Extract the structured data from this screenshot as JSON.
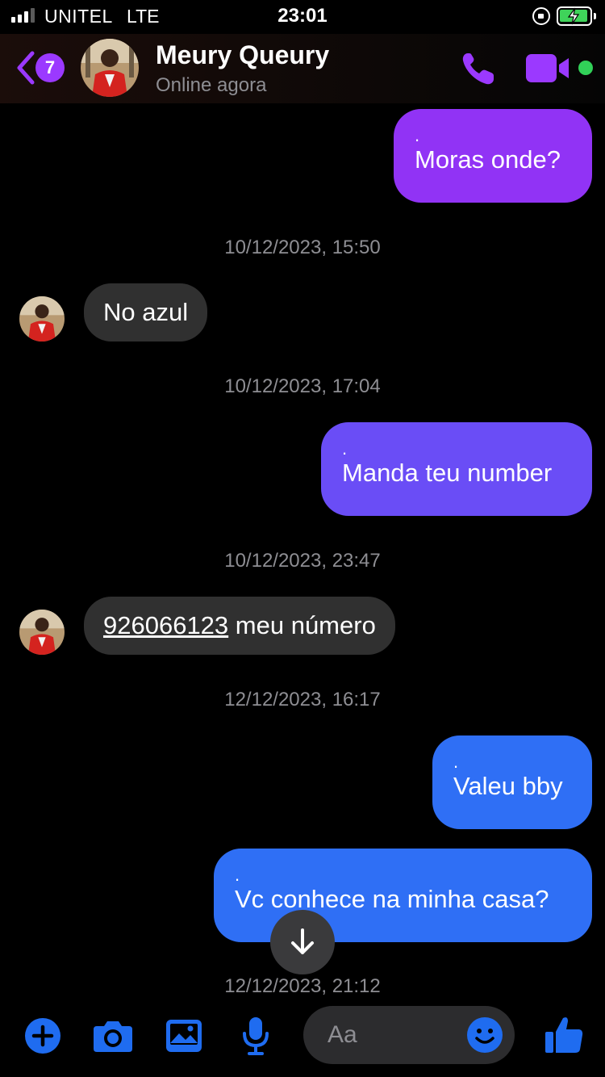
{
  "status_bar": {
    "carrier": "UNITEL",
    "network": "LTE",
    "time": "23:01"
  },
  "header": {
    "unread_count": "7",
    "name": "Meury Queury",
    "status": "Online agora"
  },
  "messages": [
    {
      "direction": "outgoing",
      "marker": ".",
      "text": "Moras onde?",
      "color": "#9133f5"
    },
    {
      "timestamp": "10/12/2023, 15:50"
    },
    {
      "direction": "incoming",
      "text": "No azul"
    },
    {
      "timestamp": "10/12/2023, 17:04"
    },
    {
      "direction": "outgoing",
      "marker": ".",
      "text": "Manda teu number",
      "color": "#6a4df6"
    },
    {
      "timestamp": "10/12/2023, 23:47"
    },
    {
      "direction": "incoming",
      "phone": "926066123",
      "text": " meu número"
    },
    {
      "timestamp": "12/12/2023, 16:17"
    },
    {
      "direction": "outgoing",
      "marker": ".",
      "text": "Valeu bby",
      "color": "#2f6ff5"
    },
    {
      "direction": "outgoing",
      "marker": ".",
      "text": "Vc conhece na minha casa?",
      "color": "#2f6ff5"
    },
    {
      "timestamp": "12/12/2023, 21:12"
    }
  ],
  "composer": {
    "placeholder": "Aa"
  },
  "colors": {
    "accent_purple": "#9b39ff",
    "accent_blue": "#1f6cf0",
    "online_green": "#31d158",
    "incoming_bubble": "#303030"
  },
  "icons": [
    "back-icon",
    "call-icon",
    "video-icon",
    "scroll-down-icon",
    "plus-icon",
    "camera-icon",
    "gallery-icon",
    "microphone-icon",
    "emoji-icon",
    "thumbs-up-icon"
  ]
}
